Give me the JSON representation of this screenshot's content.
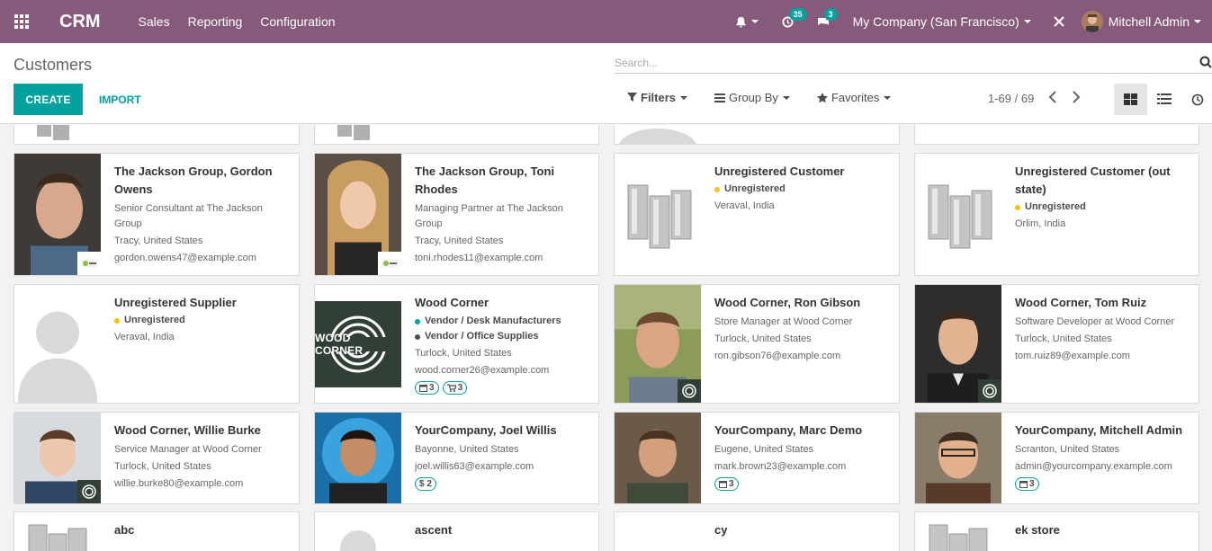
{
  "navbar": {
    "app_name": "CRM",
    "menu": [
      "Sales",
      "Reporting",
      "Configuration"
    ],
    "activity_count": "35",
    "message_count": "3",
    "company": "My Company (San Francisco)",
    "user": "Mitchell Admin"
  },
  "control_panel": {
    "title": "Customers",
    "create_label": "CREATE",
    "import_label": "IMPORT",
    "search_placeholder": "Search...",
    "filters_label": "Filters",
    "groupby_label": "Group By",
    "favorites_label": "Favorites",
    "pager": "1-69 / 69"
  },
  "colors": {
    "navbar": "#875a7b",
    "primary": "#00a09d"
  },
  "cards": {
    "row1": [
      {
        "name": "The Jackson Group, Gordon Owens",
        "lines": [
          "Senior Consultant at The Jackson Group",
          "Tracy, United States",
          "gordon.owens47@example.com"
        ]
      },
      {
        "name": "The Jackson Group, Toni Rhodes",
        "lines": [
          "Managing Partner at The Jackson Group",
          "Tracy, United States",
          "toni.rhodes11@example.com"
        ]
      },
      {
        "name": "Unregistered Customer",
        "tag": "Unregistered",
        "lines": [
          "Veraval, India"
        ]
      },
      {
        "name": "Unregistered Customer (out state)",
        "tag": "Unregistered",
        "lines": [
          "Orlim, India"
        ]
      }
    ],
    "row2": [
      {
        "name": "Unregistered Supplier",
        "tag": "Unregistered",
        "lines": [
          "Veraval, India"
        ]
      },
      {
        "name": "Wood Corner",
        "tags": [
          "Vendor / Desk Manufacturers",
          "Vendor / Office Supplies"
        ],
        "lines": [
          "Turlock, United States",
          "wood.corner26@example.com"
        ],
        "pills": [
          "3",
          "3"
        ],
        "logo_text": "WOOD CORNER"
      },
      {
        "name": "Wood Corner, Ron Gibson",
        "lines": [
          "Store Manager at Wood Corner",
          "Turlock, United States",
          "ron.gibson76@example.com"
        ]
      },
      {
        "name": "Wood Corner, Tom Ruiz",
        "lines": [
          "Software Developer at Wood Corner",
          "Turlock, United States",
          "tom.ruiz89@example.com"
        ]
      }
    ],
    "row3": [
      {
        "name": "Wood Corner, Willie Burke",
        "lines": [
          "Service Manager at Wood Corner",
          "Turlock, United States",
          "willie.burke80@example.com"
        ]
      },
      {
        "name": "YourCompany, Joel Willis",
        "lines": [
          "Bayonne, United States",
          "joel.willis63@example.com"
        ],
        "pill": "$ 2"
      },
      {
        "name": "YourCompany, Marc Demo",
        "lines": [
          "Eugene, United States",
          "mark.brown23@example.com"
        ],
        "pill": "3"
      },
      {
        "name": "YourCompany, Mitchell Admin",
        "lines": [
          "Scranton, United States",
          "admin@yourcompany.example.com"
        ],
        "pill": "3"
      }
    ],
    "row4": [
      {
        "name": "abc"
      },
      {
        "name": "ascent"
      },
      {
        "name": "cy"
      },
      {
        "name": "ek store"
      }
    ]
  }
}
